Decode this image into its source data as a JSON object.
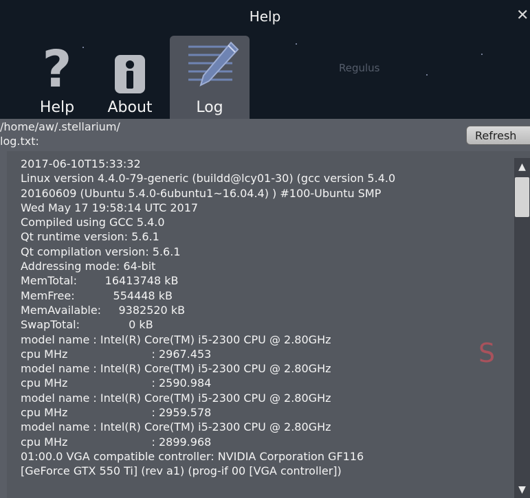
{
  "window": {
    "title": "Help",
    "close_icon": "close-icon"
  },
  "background": {
    "star_label": "Regulus",
    "marker_letter": "S"
  },
  "tabs": [
    {
      "label": "Help",
      "icon": "help-icon"
    },
    {
      "label": "About",
      "icon": "info-icon"
    },
    {
      "label": "Log",
      "icon": "pen-icon",
      "active": true
    }
  ],
  "log": {
    "path": "/home/aw/.stellarium/\nlog.txt:",
    "refresh_label": "Refresh",
    "lines": [
      "2017-06-10T15:33:32",
      "Linux version 4.4.0-79-generic (buildd@lcy01-30) (gcc version 5.4.0",
      "20160609 (Ubuntu 5.4.0-6ubuntu1~16.04.4) ) #100-Ubuntu SMP",
      "Wed May 17 19:58:14 UTC 2017",
      "Compiled using GCC 5.4.0",
      "Qt runtime version: 5.6.1",
      "Qt compilation version: 5.6.1",
      "Addressing mode: 64-bit",
      "MemTotal:        16413748 kB",
      "MemFree:           554448 kB",
      "MemAvailable:     9382520 kB",
      "SwapTotal:              0 kB",
      "model name : Intel(R) Core(TM) i5-2300 CPU @ 2.80GHz",
      "cpu MHz                        : 2967.453",
      "model name : Intel(R) Core(TM) i5-2300 CPU @ 2.80GHz",
      "cpu MHz                        : 2590.984",
      "model name : Intel(R) Core(TM) i5-2300 CPU @ 2.80GHz",
      "cpu MHz                        : 2959.578",
      "model name : Intel(R) Core(TM) i5-2300 CPU @ 2.80GHz",
      "cpu MHz                        : 2899.968",
      "01:00.0 VGA compatible controller: NVIDIA Corporation GF116",
      "[GeForce GTX 550 Ti] (rev a1) (prog-if 00 [VGA controller])"
    ]
  },
  "colors": {
    "active_tab": "#4f535c",
    "panel": "#54585f",
    "title_bg": "#111923"
  }
}
